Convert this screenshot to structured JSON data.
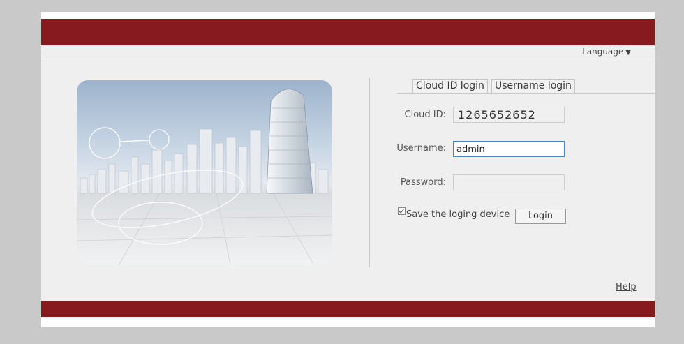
{
  "header": {
    "language_label": "Language",
    "language_arrow": "▼"
  },
  "tabs": [
    {
      "label": "Cloud ID login"
    },
    {
      "label": "Username login"
    }
  ],
  "form": {
    "cloud_id": {
      "label": "Cloud ID:",
      "value": "1265652652"
    },
    "username": {
      "label": "Username:",
      "value": "admin"
    },
    "password": {
      "label": "Password:",
      "value": ""
    },
    "save_device": {
      "label": "Save the loging device",
      "checked": true
    },
    "login_button": "Login"
  },
  "footer": {
    "help_link": "Help"
  },
  "colors": {
    "brand": "#861a1f",
    "focus": "#4a83c5"
  },
  "hero": {
    "icon": "city-skyline-illustration"
  }
}
